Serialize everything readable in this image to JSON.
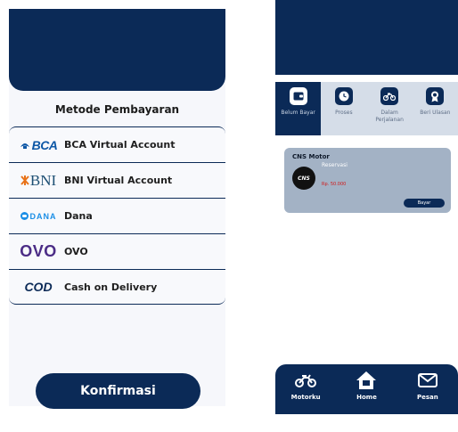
{
  "left_screen": {
    "section_title": "Metode Pembayaran",
    "payment_methods": [
      {
        "logo_text": "BCA",
        "label": "BCA Virtual Account"
      },
      {
        "logo_text": "BNI",
        "label": "BNI Virtual Account"
      },
      {
        "logo_text": "DANA",
        "label": "Dana"
      },
      {
        "logo_text": "OVO",
        "label": "OVO"
      },
      {
        "logo_text": "COD",
        "label": "Cash on Delivery"
      }
    ],
    "confirm_button": "Konfirmasi"
  },
  "right_screen": {
    "tabs": [
      {
        "label": "Belum Bayar",
        "icon": "wallet-icon",
        "active": true
      },
      {
        "label": "Proses",
        "icon": "clock-icon",
        "active": false
      },
      {
        "label": "Dalam Perjalanan",
        "icon": "motorcycle-icon",
        "active": false
      },
      {
        "label": "Beri Ulasan",
        "icon": "award-icon",
        "active": false
      }
    ],
    "order_card": {
      "company": "CNS Motor",
      "thumbnail_text": "CNS",
      "status": "Reservasi",
      "price": "Rp. 50.000",
      "pay_button": "Bayar"
    },
    "bottom_nav": [
      {
        "label": "Motorku",
        "icon": "motorcycle-icon"
      },
      {
        "label": "Home",
        "icon": "home-icon"
      },
      {
        "label": "Pesan",
        "icon": "mail-icon"
      }
    ]
  },
  "colors": {
    "primary_navy": "#0b2a57",
    "tab_background": "#d5dde8",
    "card_background": "#a3b2c5",
    "price_red": "#d01818"
  }
}
